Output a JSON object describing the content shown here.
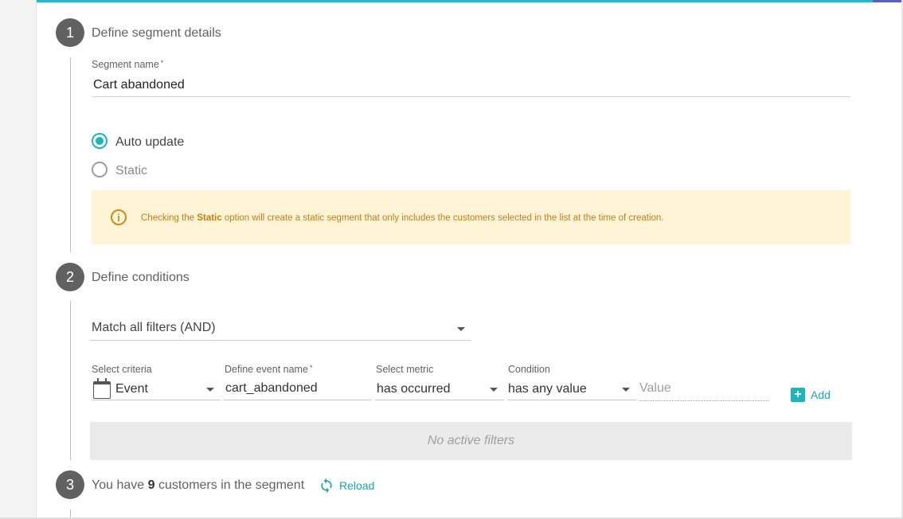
{
  "step1": {
    "number": "1",
    "title": "Define segment details",
    "segment_name_label": "Segment name",
    "required_mark": "*",
    "segment_name_value": "Cart abandoned",
    "radio_auto_label": "Auto update",
    "radio_static_label": "Static",
    "alert": {
      "icon": "i",
      "prefix": "Checking the ",
      "bold": "Static",
      "suffix": " option will create a static segment that only includes the customers selected in the list at the time of creation."
    }
  },
  "step2": {
    "number": "2",
    "title": "Define conditions",
    "match_value": "Match all filters (AND)",
    "criteria_label": "Select criteria",
    "criteria_value": "Event",
    "event_name_label": "Define event name",
    "event_name_value": "cart_abandoned",
    "metric_label": "Select metric",
    "metric_value": "has occurred",
    "condition_label": "Condition",
    "condition_value": "has any value",
    "value_placeholder": "Value",
    "add_label": "Add",
    "add_icon": "+",
    "no_filters": "No active filters"
  },
  "step3": {
    "number": "3",
    "prefix": "You have ",
    "count": "9",
    "suffix": " customers in the segment",
    "reload_label": "Reload"
  },
  "colors": {
    "accent": "#1cb5b9",
    "alert_bg": "#fff4d6",
    "alert_text": "#c17d14",
    "step_circle": "#616161"
  }
}
